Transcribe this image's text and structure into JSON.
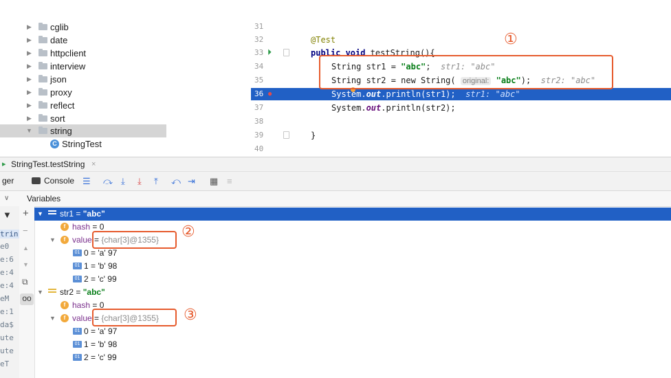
{
  "project_tree": {
    "folders": [
      "cglib",
      "date",
      "httpclient",
      "interview",
      "json",
      "proxy",
      "reflect",
      "sort",
      "string"
    ],
    "class_file": "StringTest"
  },
  "editor": {
    "line_numbers": [
      "31",
      "32",
      "33",
      "34",
      "35",
      "36",
      "37",
      "38",
      "39",
      "40"
    ],
    "lines": {
      "l32": "@Test",
      "l33_kw": "public void",
      "l33_rest": " testString(){",
      "l34_a": "String str1 = ",
      "l34_str": "\"abc\"",
      "l34_b": ";  ",
      "l34_hint": "str1: \"abc\"",
      "l35_a": "String str2 = new String( ",
      "l35_param": "original:",
      "l35_str": " \"abc\"",
      "l35_b": ");  ",
      "l35_hint": "str2: \"abc\"",
      "l36_a": "System.",
      "l36_out": "out",
      "l36_b": ".println(str1);  ",
      "l36_hint": "str1: \"abc\"",
      "l37_a": "System.",
      "l37_out": "out",
      "l37_b": ".println(str2);",
      "l39": "}"
    },
    "callouts": [
      "①",
      "②",
      "③"
    ]
  },
  "debug": {
    "session_tab": "StringTest.testString",
    "left_tab": "ger",
    "console_tab": "Console",
    "variables_header": "Variables",
    "left_strip": [
      "trin",
      "e0",
      "e:6",
      "e:4",
      "e:4",
      "eM",
      "e:1",
      "da$",
      "ute",
      "ute",
      "eT"
    ]
  },
  "variables": [
    {
      "indent": 0,
      "kind": "local",
      "expanded": true,
      "name": "str1",
      "eq": " = ",
      "value": "\"abc\"",
      "selected": true
    },
    {
      "indent": 1,
      "kind": "field",
      "name": "hash",
      "eq": " = ",
      "value": "0"
    },
    {
      "indent": 1,
      "kind": "field",
      "expanded": true,
      "name": "value",
      "eq": " = ",
      "value": "{char[3]@1355}"
    },
    {
      "indent": 2,
      "kind": "array",
      "name": "0",
      "eq": " = ",
      "value": "'a' 97"
    },
    {
      "indent": 2,
      "kind": "array",
      "name": "1",
      "eq": " = ",
      "value": "'b' 98"
    },
    {
      "indent": 2,
      "kind": "array",
      "name": "2",
      "eq": " = ",
      "value": "'c' 99"
    },
    {
      "indent": 0,
      "kind": "local",
      "expanded": true,
      "name": "str2",
      "eq": " = ",
      "value": "\"abc\""
    },
    {
      "indent": 1,
      "kind": "field",
      "name": "hash",
      "eq": " = ",
      "value": "0"
    },
    {
      "indent": 1,
      "kind": "field",
      "expanded": true,
      "name": "value",
      "eq": " = ",
      "value": "{char[3]@1355}"
    },
    {
      "indent": 2,
      "kind": "array",
      "name": "0",
      "eq": " = ",
      "value": "'a' 97"
    },
    {
      "indent": 2,
      "kind": "array",
      "name": "1",
      "eq": " = ",
      "value": "'b' 98"
    },
    {
      "indent": 2,
      "kind": "array",
      "name": "2",
      "eq": " = ",
      "value": "'c' 99"
    }
  ],
  "colors": {
    "accent": "#2160c5",
    "callout": "#e65a2c"
  }
}
